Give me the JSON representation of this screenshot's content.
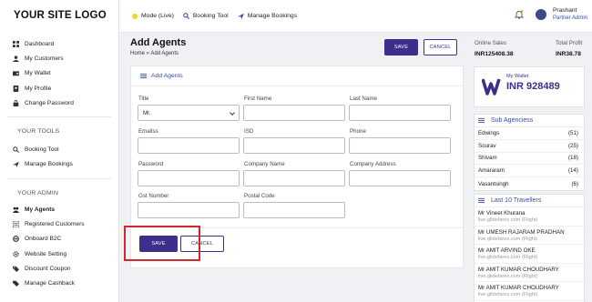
{
  "sidebar": {
    "logo": "YOUR SITE LOGO",
    "main_items": [
      {
        "label": "Dashboard",
        "icon": "dashboard-icon"
      },
      {
        "label": "My Customers",
        "icon": "users-icon"
      },
      {
        "label": "My Wallet",
        "icon": "wallet-icon"
      },
      {
        "label": "My Profile",
        "icon": "user-icon"
      },
      {
        "label": "Change Password",
        "icon": "lock-icon"
      }
    ],
    "tools_title": "YOUR TOOLS",
    "tools_items": [
      {
        "label": "Booking Tool",
        "icon": "search-icon"
      },
      {
        "label": "Manage Bookings",
        "icon": "plane-icon"
      }
    ],
    "admin_title": "YOUR ADMIN",
    "admin_items": [
      {
        "label": "My Agents",
        "icon": "agents-icon",
        "active": true
      },
      {
        "label": "Registered Customers",
        "icon": "list-icon"
      },
      {
        "label": "Onboard B2C",
        "icon": "globe-icon"
      },
      {
        "label": "Website Setting",
        "icon": "settings-icon"
      },
      {
        "label": "Discount Coupon",
        "icon": "tag-icon"
      },
      {
        "label": "Manage Cashback",
        "icon": "cashback-icon"
      }
    ]
  },
  "topbar": {
    "mode": "Mode (Live)",
    "booking_tool": "Booking Tool",
    "manage_bookings": "Manage Bookings",
    "user_name": "Prashant",
    "user_role": "Partner Admin"
  },
  "page": {
    "title": "Add Agents",
    "breadcrumb": "Home » Add Agents",
    "save": "SAVE",
    "cancel": "CANCEL"
  },
  "form": {
    "heading": "Add Agents",
    "fields": {
      "title_label": "Title",
      "title_value": "Mr.",
      "first_name_label": "First Name",
      "last_name_label": "Last Name",
      "email_label": "Emailss",
      "isd_label": "ISD",
      "phone_label": "Phone",
      "password_label": "Password",
      "company_name_label": "Company Name",
      "company_address_label": "Company Address",
      "gst_label": "Gst Number",
      "postal_label": "Postal Code"
    },
    "save": "SAVE",
    "cancel": "CANCEL"
  },
  "right_panel": {
    "online_sales_label": "Online Sales",
    "online_sales_value": "INR125408.38",
    "total_profit_label": "Total Profit",
    "total_profit_value": "INR38.78",
    "wallet_caption": "My Wallet",
    "wallet_amount": "INR 928489",
    "sub_agencies_title": "Sub Agenciess",
    "sub_agencies": [
      {
        "name": "Edwings",
        "count": "(51)"
      },
      {
        "name": "Sourav",
        "count": "(25)"
      },
      {
        "name": "Shivam",
        "count": "(18)"
      },
      {
        "name": "Amararam",
        "count": "(14)"
      },
      {
        "name": "Vasantsingh",
        "count": "(6)"
      }
    ],
    "travellers_title": "Last 10 Travellers",
    "travellers": [
      {
        "name": "Mr Vineet Khurana",
        "sub": "live.glidefares.com (Flight)"
      },
      {
        "name": "Mr UMESH RAJARAM PRADHAN",
        "sub": "live.glidefares.com (Flight)"
      },
      {
        "name": "Mr AMIT ARVIND OKE",
        "sub": "live.glidefares.com (Flight)"
      },
      {
        "name": "Mr AMIT KUMAR CHOUDHARY",
        "sub": "live.glidefares.com (Flight)"
      },
      {
        "name": "Mr AMIT KUMAR CHOUDHARY",
        "sub": "live.glidefares.com (Flight)"
      }
    ]
  },
  "colors": {
    "accent": "#3c2f8c",
    "link": "#3a4aa5",
    "highlight": "#d6262d",
    "mode_dot": "#f1d61c"
  }
}
